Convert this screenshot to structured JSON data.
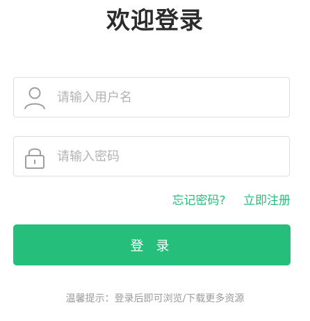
{
  "title": "欢迎登录",
  "username": {
    "placeholder": "请输入用户名",
    "icon": "user-icon"
  },
  "password": {
    "placeholder": "请输入密码",
    "icon": "lock-icon"
  },
  "links": {
    "forgot": "忘记密码?",
    "register": "立即注册"
  },
  "login_button": "登 录",
  "tip": "温馨提示：登录后即可浏览/下载更多资源",
  "colors": {
    "accent": "#26be7b",
    "link": "#24bd7a",
    "border": "#dedede"
  }
}
